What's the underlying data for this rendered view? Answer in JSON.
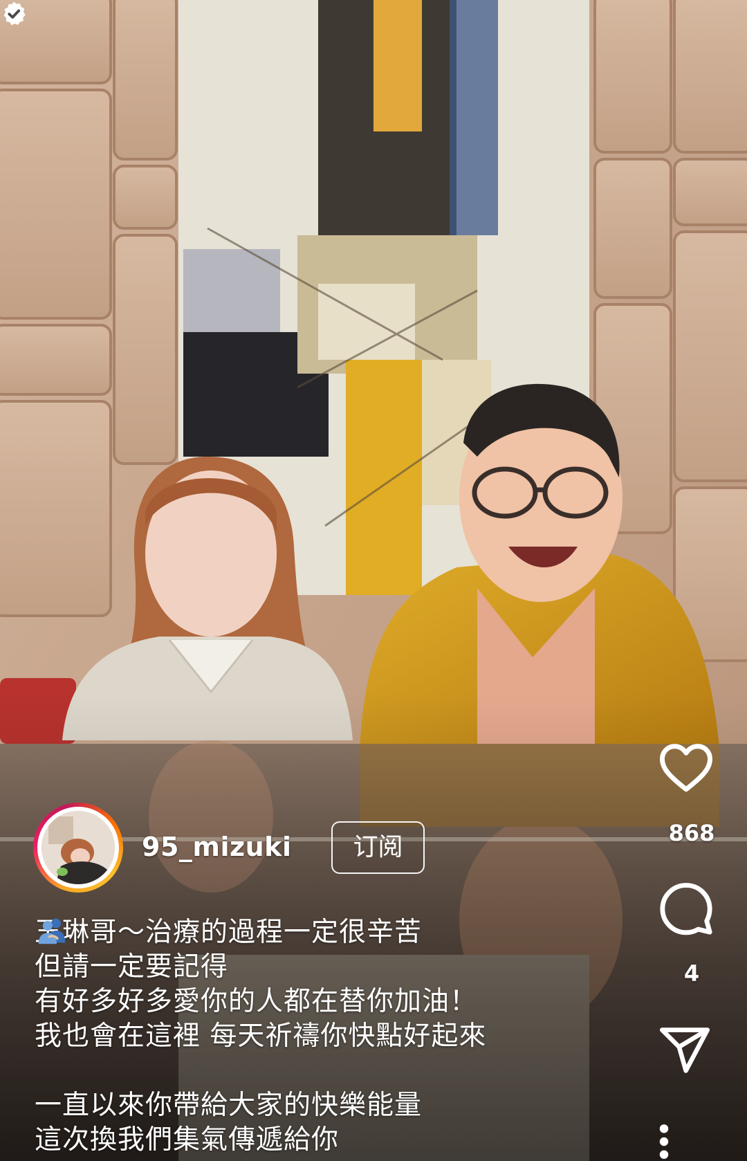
{
  "post": {
    "author": {
      "username": "95_mizuki",
      "verified": true,
      "avatar_icon": "profile-photo",
      "ring_colors": [
        "#f9a825",
        "#e91e63",
        "#c2185b"
      ]
    },
    "follow_button_label": "订阅",
    "caption_lines": [
      "玉琳哥～治療的過程一定很辛苦",
      "但請一定要記得",
      "有好多好多愛你的人都在替你加油！",
      "我也會在這裡 每天祈禱你快點好起來",
      "",
      "一直以來你帶給大家的快樂能量",
      "這次換我們集氣傳遞給你"
    ],
    "caption_emoji": "people-hugging-emoji"
  },
  "actions": {
    "like": {
      "icon": "heart-icon",
      "count": "868"
    },
    "comment": {
      "icon": "comment-bubble-icon",
      "count": "4"
    },
    "share": {
      "icon": "paper-plane-icon"
    },
    "more": {
      "icon": "more-vertical-icon"
    }
  },
  "video": {
    "scene": "video-frame"
  }
}
